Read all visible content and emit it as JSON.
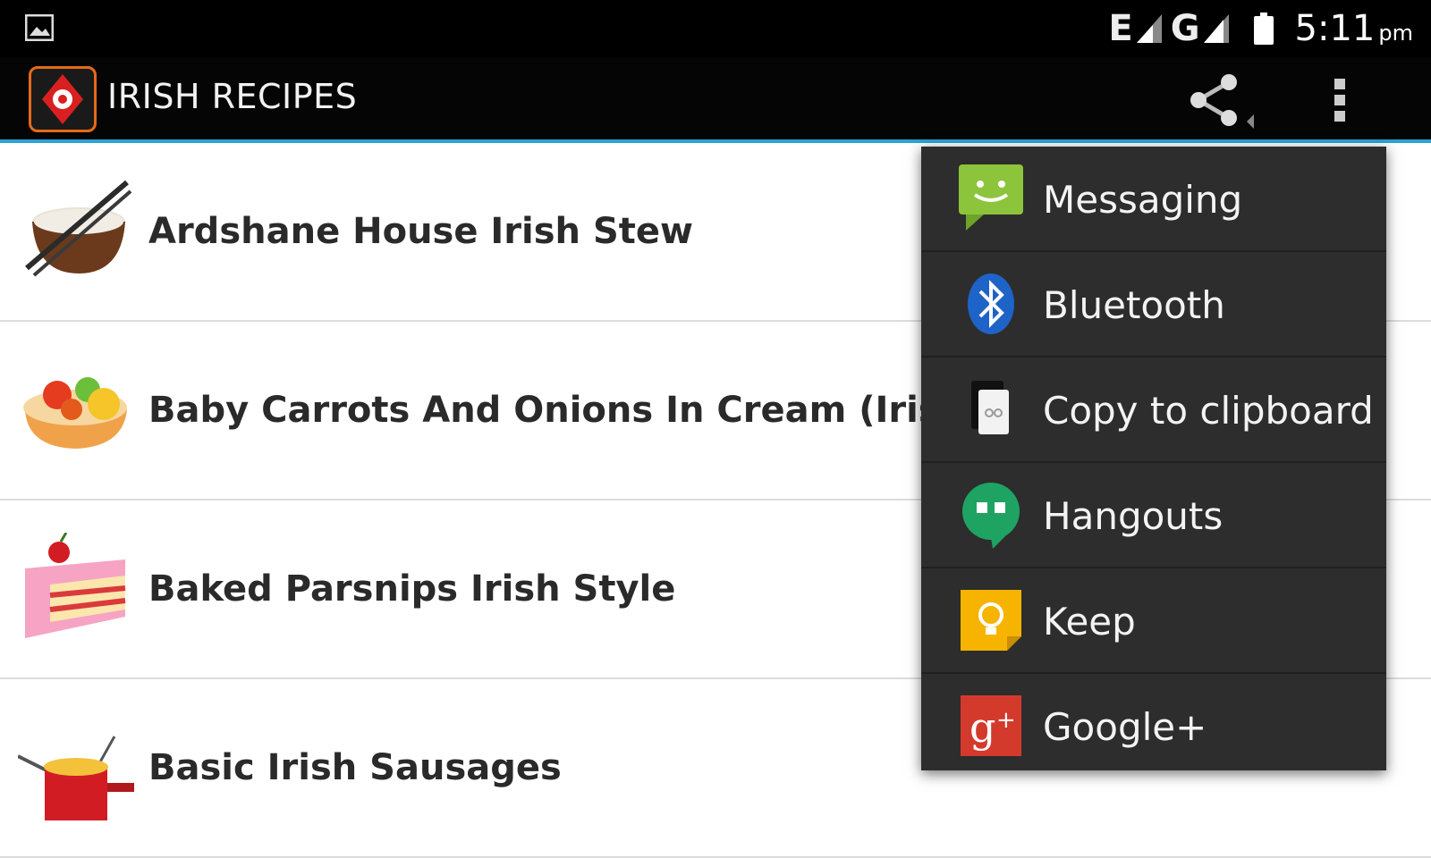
{
  "status_bar": {
    "network1": "E",
    "network2": "G",
    "time": "5:11",
    "ampm": "pm",
    "icons": [
      "image-notification-icon",
      "signal-icon",
      "battery-icon"
    ]
  },
  "app_bar": {
    "title": "IRISH RECIPES",
    "accent_color": "#29a3d6",
    "actions": [
      "share-icon",
      "overflow-menu-icon"
    ]
  },
  "recipes": [
    {
      "title": "Ardshane House Irish Stew",
      "icon": "stew-bowl-icon"
    },
    {
      "title": "Baby Carrots And Onions In Cream (Irish)",
      "icon": "fruit-tart-icon"
    },
    {
      "title": "Baked Parsnips Irish Style",
      "icon": "cake-slice-icon"
    },
    {
      "title": "Basic Irish Sausages",
      "icon": "saucepan-icon"
    }
  ],
  "share_menu": {
    "items": [
      {
        "label": "Messaging",
        "icon": "messaging-icon"
      },
      {
        "label": "Bluetooth",
        "icon": "bluetooth-icon"
      },
      {
        "label": "Copy to clipboard",
        "icon": "clipboard-icon"
      },
      {
        "label": "Hangouts",
        "icon": "hangouts-icon"
      },
      {
        "label": "Keep",
        "icon": "keep-icon"
      },
      {
        "label": "Google+",
        "icon": "google-plus-icon"
      }
    ]
  }
}
